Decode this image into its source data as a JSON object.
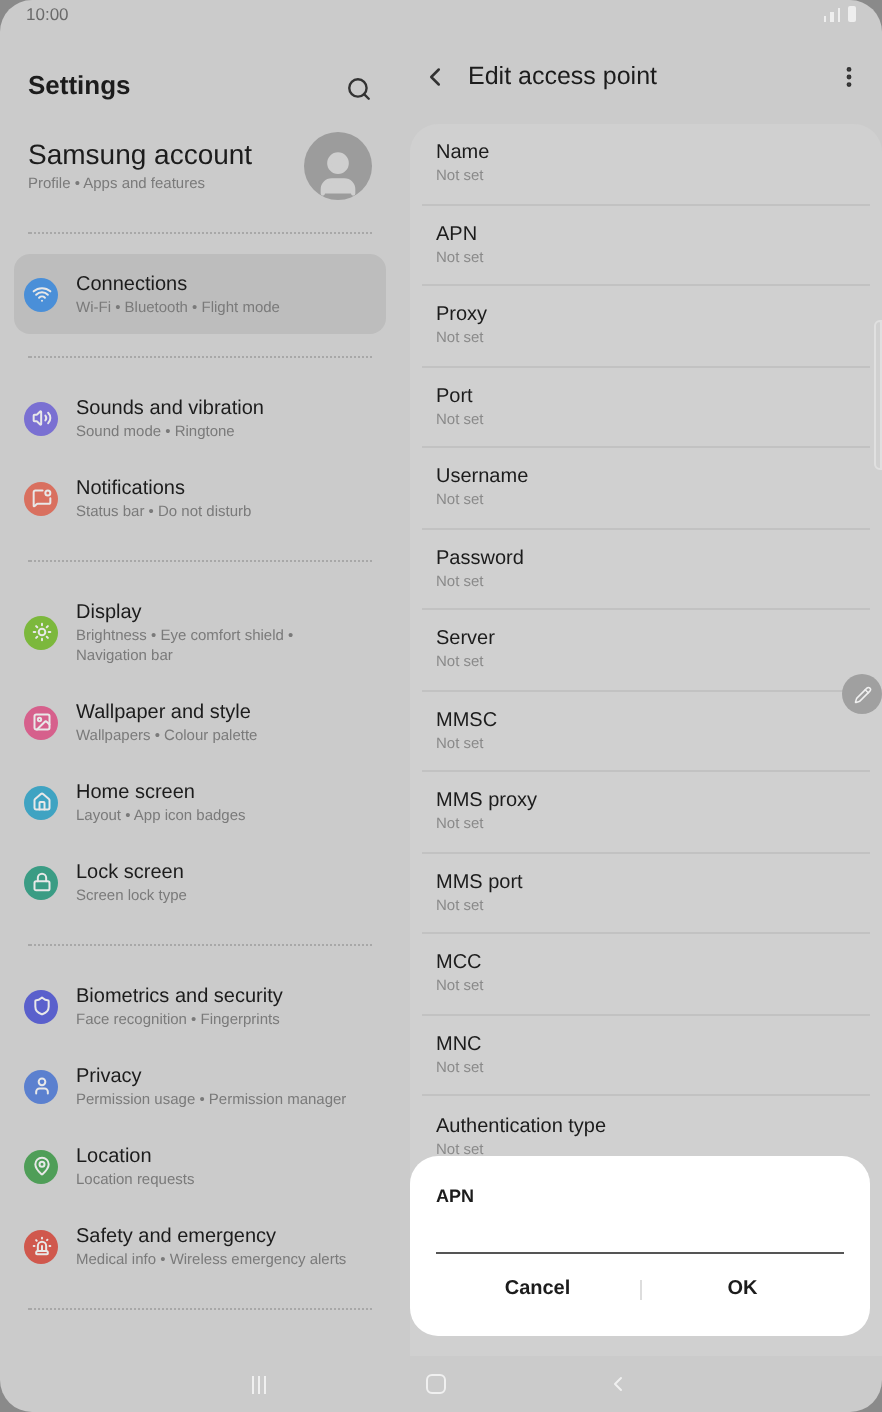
{
  "status_bar": {
    "time": "10:00"
  },
  "settings": {
    "title": "Settings",
    "account": {
      "title": "Samsung account",
      "subtitle": "Profile • Apps and features"
    },
    "groups": [
      [
        {
          "label": "Connections",
          "subtitle": "Wi-Fi • Bluetooth • Flight mode",
          "color": "#4a8fd8",
          "selected": true
        }
      ],
      [
        {
          "label": "Sounds and vibration",
          "subtitle": "Sound mode • Ringtone",
          "color": "#7a70d2",
          "selected": false
        },
        {
          "label": "Notifications",
          "subtitle": "Status bar • Do not disturb",
          "color": "#d9705f",
          "selected": false
        }
      ],
      [
        {
          "label": "Display",
          "subtitle": "Brightness • Eye comfort shield • Navigation bar",
          "color": "#7cb83c",
          "selected": false
        },
        {
          "label": "Wallpaper and style",
          "subtitle": "Wallpapers • Colour palette",
          "color": "#d6608c",
          "selected": false
        },
        {
          "label": "Home screen",
          "subtitle": "Layout • App icon badges",
          "color": "#3fa3c2",
          "selected": false
        },
        {
          "label": "Lock screen",
          "subtitle": "Screen lock type",
          "color": "#3a9c84",
          "selected": false
        }
      ],
      [
        {
          "label": "Biometrics and security",
          "subtitle": "Face recognition • Fingerprints",
          "color": "#5a60cc",
          "selected": false
        },
        {
          "label": "Privacy",
          "subtitle": "Permission usage • Permission manager",
          "color": "#5b80cf",
          "selected": false
        },
        {
          "label": "Location",
          "subtitle": "Location requests",
          "color": "#4f9e58",
          "selected": false
        },
        {
          "label": "Safety and emergency",
          "subtitle": "Medical info • Wireless emergency alerts",
          "color": "#d0584d",
          "selected": false
        }
      ]
    ]
  },
  "access_point": {
    "title": "Edit access point",
    "fields": [
      {
        "label": "Name",
        "value": "Not set"
      },
      {
        "label": "APN",
        "value": "Not set"
      },
      {
        "label": "Proxy",
        "value": "Not set"
      },
      {
        "label": "Port",
        "value": "Not set"
      },
      {
        "label": "Username",
        "value": "Not set"
      },
      {
        "label": "Password",
        "value": "Not set"
      },
      {
        "label": "Server",
        "value": "Not set"
      },
      {
        "label": "MMSC",
        "value": "Not set"
      },
      {
        "label": "MMS proxy",
        "value": "Not set"
      },
      {
        "label": "MMS port",
        "value": "Not set"
      },
      {
        "label": "MCC",
        "value": "Not set"
      },
      {
        "label": "MNC",
        "value": "Not set"
      },
      {
        "label": "Authentication type",
        "value": "Not set"
      }
    ]
  },
  "dialog": {
    "title": "APN",
    "buttons": [
      "Cancel",
      "OK"
    ]
  }
}
